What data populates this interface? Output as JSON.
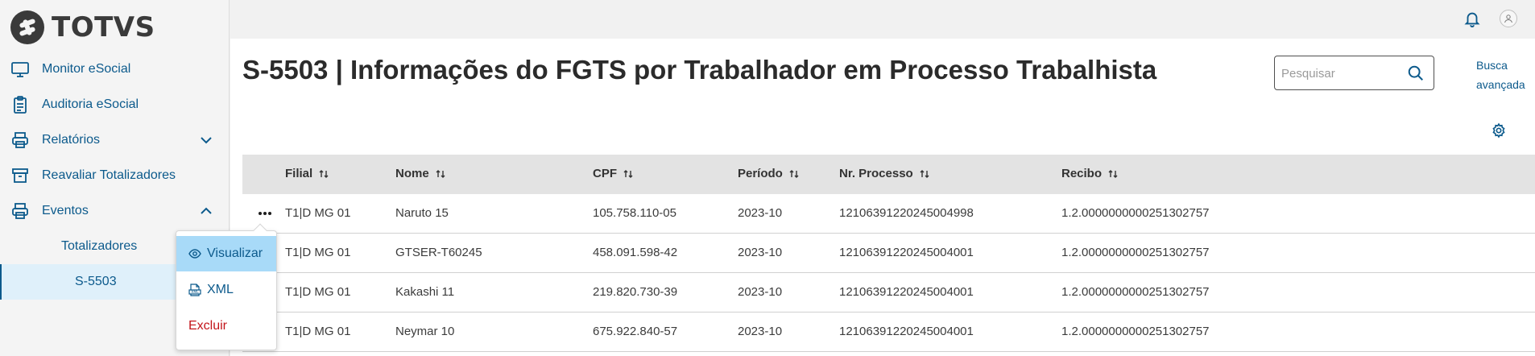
{
  "brand": {
    "name": "TOTVS"
  },
  "sidebar": {
    "items": [
      {
        "label": "Monitor eSocial",
        "icon": "monitor-icon"
      },
      {
        "label": "Auditoria eSocial",
        "icon": "clipboard-icon"
      },
      {
        "label": "Relatórios",
        "icon": "printer-icon",
        "expanded": false
      },
      {
        "label": "Reavaliar Totalizadores",
        "icon": "archive-icon"
      },
      {
        "label": "Eventos",
        "icon": "printer-icon",
        "expanded": true
      }
    ],
    "subitems": [
      {
        "label": "Totalizadores"
      },
      {
        "label": "S-5503",
        "active": true
      }
    ]
  },
  "header": {
    "title": "S-5503 | Informações do FGTS por Trabalhador em Processo Trabalhista",
    "search_placeholder": "Pesquisar",
    "advanced_search_line1": "Busca",
    "advanced_search_line2": "avançada"
  },
  "table": {
    "columns": [
      "Filial",
      "Nome",
      "CPF",
      "Período",
      "Nr. Processo",
      "Recibo"
    ],
    "rows": [
      [
        "T1|D MG 01",
        "Naruto 15",
        "105.758.110-05",
        "2023-10",
        "12106391220245004998",
        "1.2.0000000000251302757"
      ],
      [
        "T1|D MG 01",
        "GTSER-T60245",
        "458.091.598-42",
        "2023-10",
        "12106391220245004001",
        "1.2.0000000000251302757"
      ],
      [
        "T1|D MG 01",
        "Kakashi 11",
        "219.820.730-39",
        "2023-10",
        "12106391220245004001",
        "1.2.0000000000251302757"
      ],
      [
        "T1|D MG 01",
        "Neymar 10",
        "675.922.840-57",
        "2023-10",
        "12106391220245004001",
        "1.2.0000000000251302757"
      ]
    ]
  },
  "row_menu": {
    "items": [
      {
        "label": "Visualizar",
        "icon": "eye-icon"
      },
      {
        "label": "XML",
        "icon": "xml-file-icon"
      },
      {
        "label": "Excluir",
        "icon": ""
      }
    ]
  },
  "colors": {
    "accent": "#0c5a8c",
    "danger": "#c3141a",
    "selected": "#a8daf8",
    "header_bg": "#e3e3e3"
  }
}
